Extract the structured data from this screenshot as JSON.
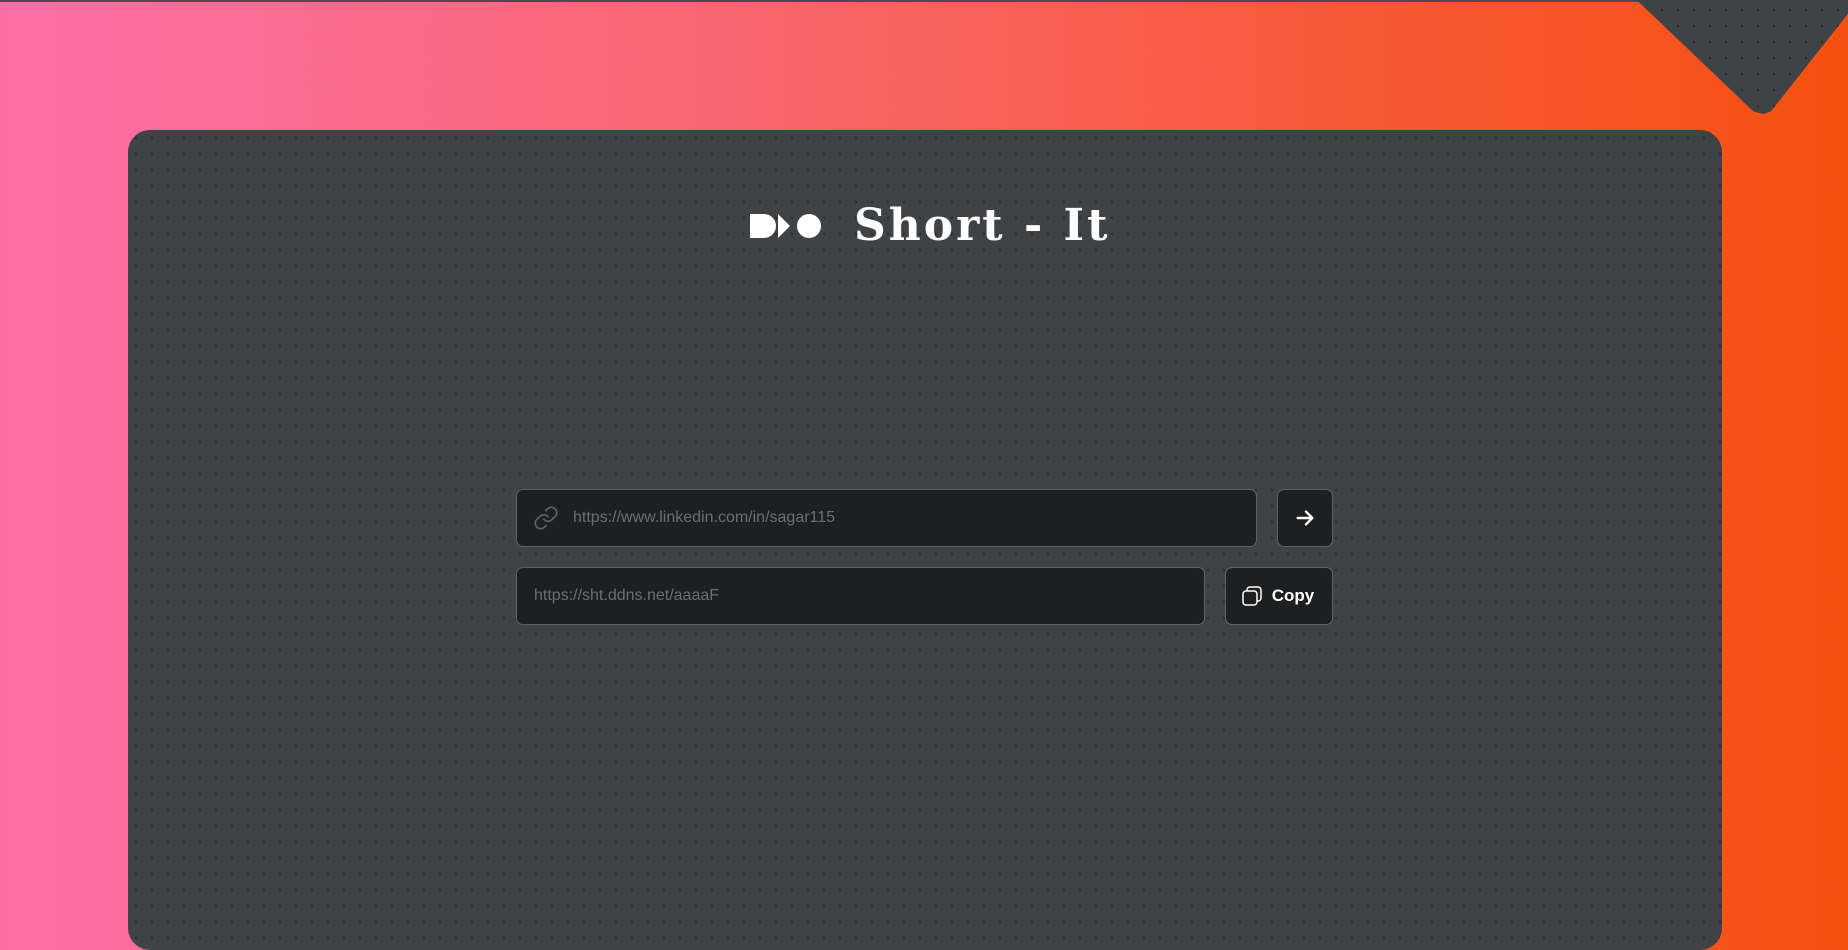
{
  "app": {
    "title": "Short - It",
    "logo_icon": "brand-logo-icon"
  },
  "shortener": {
    "url_input": {
      "placeholder": "https://www.linkedin.com/in/sagar115",
      "value": "",
      "icon": "link-icon"
    },
    "submit_button": {
      "icon": "arrow-right-icon"
    },
    "result": {
      "placeholder": "https://sht.ddns.net/aaaaF",
      "value": ""
    },
    "copy_button": {
      "label": "Copy",
      "icon": "copy-icon"
    }
  },
  "colors": {
    "gradient_start": "#fd6ea7",
    "gradient_end": "#f6500f",
    "panel": "#404346",
    "field": "#1e1f21"
  }
}
